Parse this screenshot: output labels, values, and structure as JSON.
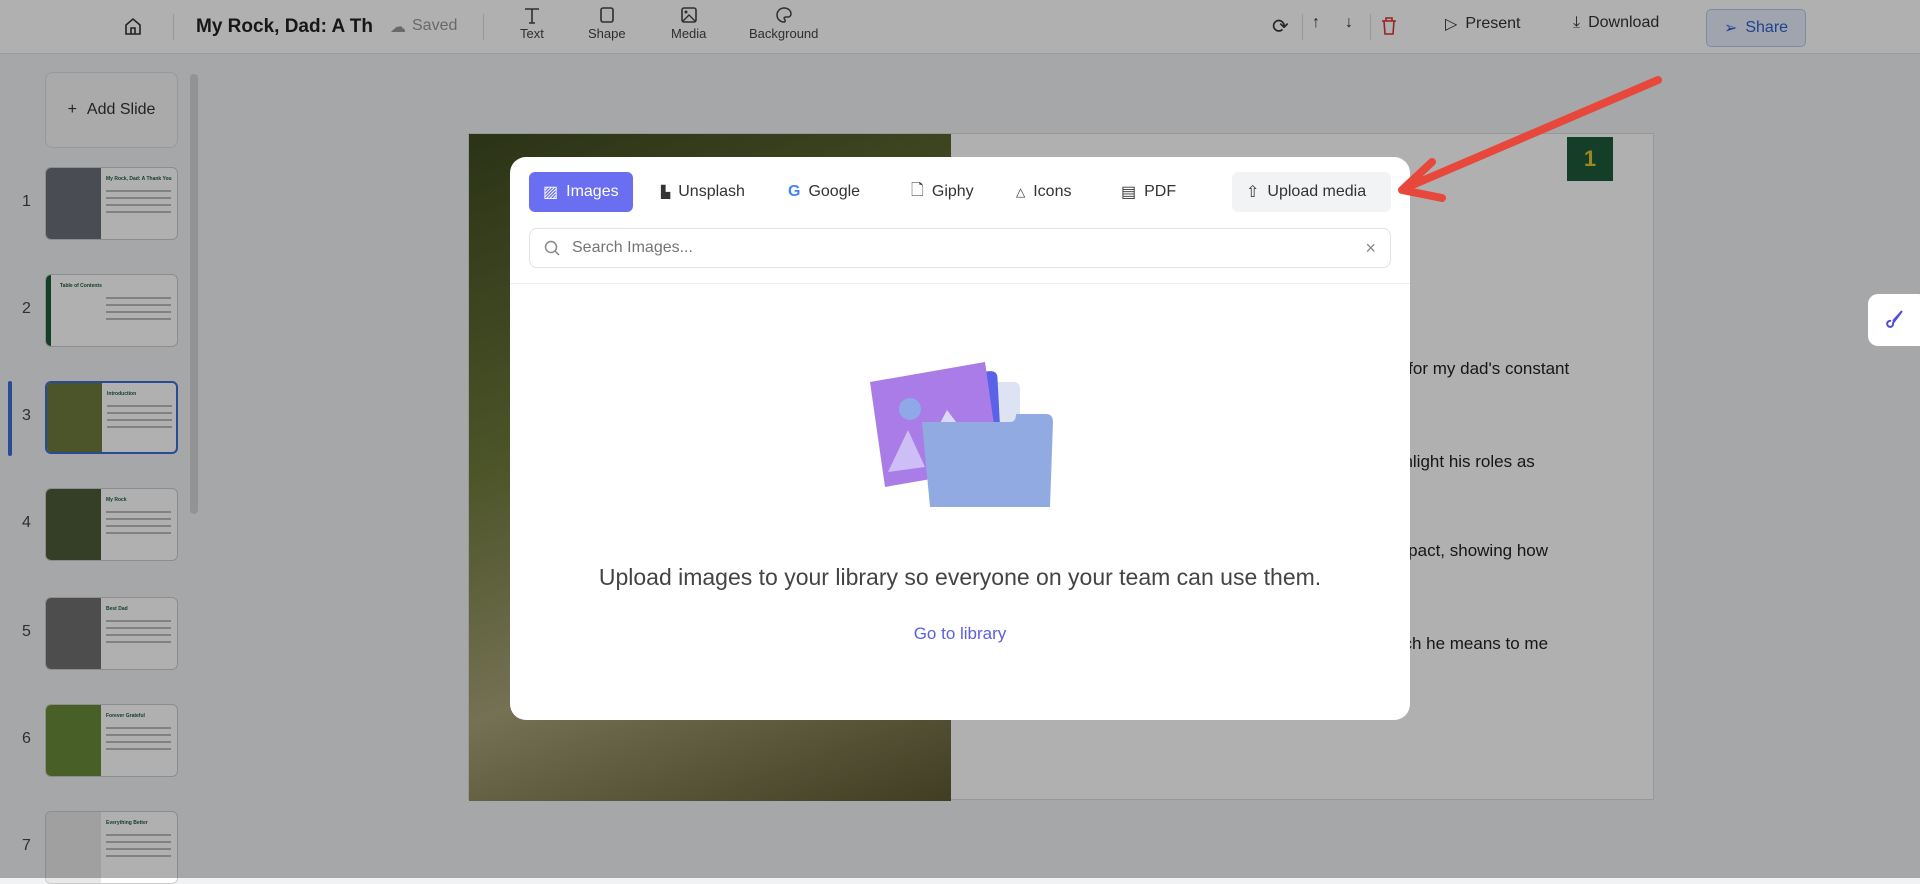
{
  "topbar": {
    "title": "My Rock, Dad: A Thai",
    "saved": "Saved",
    "tools": [
      {
        "label": "Text",
        "icon": "text-icon"
      },
      {
        "label": "Shape",
        "icon": "shape-icon"
      },
      {
        "label": "Media",
        "icon": "media-icon"
      },
      {
        "label": "Background",
        "icon": "palette-icon"
      }
    ],
    "present": "Present",
    "download": "Download",
    "share": "Share"
  },
  "sidebar": {
    "add_slide": "Add Slide",
    "slides": [
      {
        "num": "1",
        "title": "My Rock, Dad: A Thank You"
      },
      {
        "num": "2",
        "title": "Table of Contents"
      },
      {
        "num": "3",
        "title": "Introduction"
      },
      {
        "num": "4",
        "title": "My Rock"
      },
      {
        "num": "5",
        "title": "Best Dad"
      },
      {
        "num": "6",
        "title": "Forever Grateful"
      },
      {
        "num": "7",
        "title": "Everything Better"
      }
    ]
  },
  "slide": {
    "badge": "1",
    "lines": [
      "n for my dad's constant",
      "ghlight his roles as",
      "mpact, showing how",
      "uch he means to me"
    ]
  },
  "modal": {
    "tabs": [
      "Images",
      "Unsplash",
      "Google",
      "Giphy",
      "Icons",
      "PDF"
    ],
    "upload": "Upload media",
    "search_placeholder": "Search Images...",
    "message": "Upload images to your library so everyone on your team can use them.",
    "link": "Go to library"
  },
  "colors": {
    "accent": "#6a6ef0",
    "arrow": "#e8473b",
    "badge": "#1e5a3a"
  }
}
